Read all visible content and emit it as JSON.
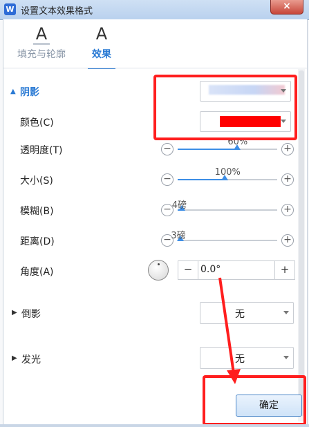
{
  "window": {
    "title": "设置文本效果格式",
    "app_icon_letter": "W",
    "close_label": "×"
  },
  "tabs": [
    {
      "glyph": "A",
      "label": "填充与轮廓"
    },
    {
      "glyph": "A",
      "label": "效果"
    }
  ],
  "shadow": {
    "section_label": "阴影",
    "color_label": "颜色(C)",
    "color_value": "#ff0000",
    "transparency": {
      "label": "透明度(T)",
      "value": "60%",
      "fraction": 0.6
    },
    "size": {
      "label": "大小(S)",
      "value": "100%",
      "fraction": 0.47
    },
    "blur": {
      "label": "模糊(B)",
      "value": "4磅",
      "fraction": 0.04
    },
    "distance": {
      "label": "距离(D)",
      "value": "3磅",
      "fraction": 0.03
    },
    "angle": {
      "label": "角度(A)",
      "value": "0.0°"
    },
    "minus_symbol": "−",
    "plus_symbol": "+"
  },
  "reflection": {
    "label": "倒影",
    "value": "无"
  },
  "glow": {
    "label": "发光",
    "value": "无"
  },
  "ok_button": {
    "label": "确定"
  },
  "colors": {
    "accent": "#2a7ad4",
    "slider": "#3d8ee6",
    "annotation": "#ff1e1e"
  }
}
